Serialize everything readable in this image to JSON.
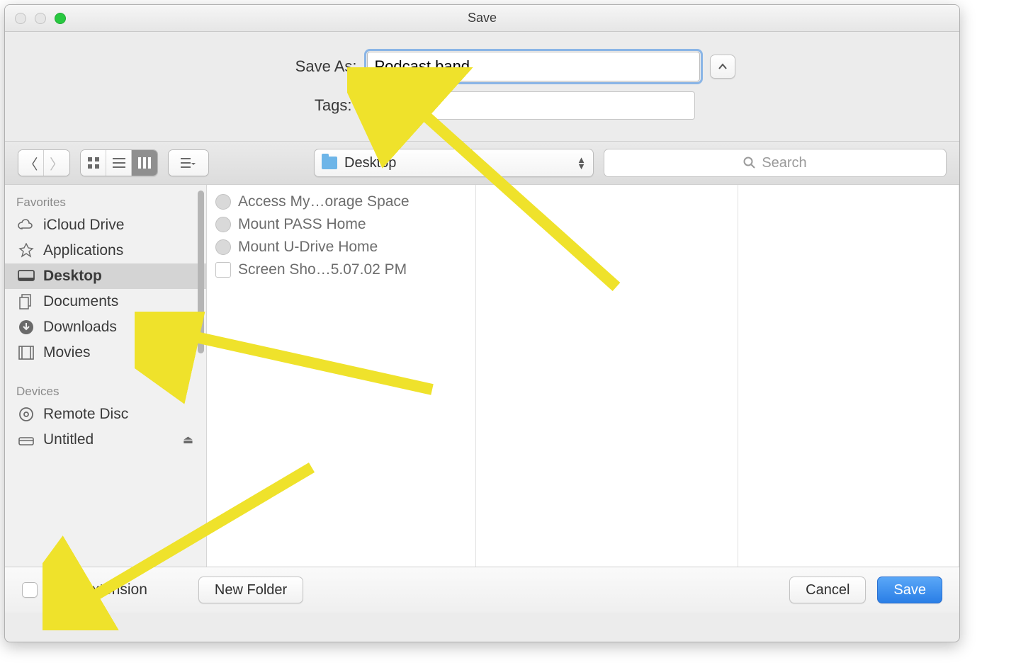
{
  "window": {
    "title": "Save"
  },
  "header": {
    "save_as_label": "Save As:",
    "filename": "Podcast.band",
    "tags_label": "Tags:",
    "tags_value": ""
  },
  "toolbar": {
    "location": "Desktop",
    "search_placeholder": "Search"
  },
  "sidebar": {
    "favorites_header": "Favorites",
    "devices_header": "Devices",
    "favorites": [
      {
        "label": "iCloud Drive",
        "icon": "cloud-icon"
      },
      {
        "label": "Applications",
        "icon": "applications-icon"
      },
      {
        "label": "Desktop",
        "icon": "desktop-icon",
        "selected": true
      },
      {
        "label": "Documents",
        "icon": "documents-icon"
      },
      {
        "label": "Downloads",
        "icon": "downloads-icon"
      },
      {
        "label": "Movies",
        "icon": "movies-icon"
      }
    ],
    "devices": [
      {
        "label": "Remote Disc",
        "icon": "disc-icon"
      },
      {
        "label": "Untitled",
        "icon": "drive-icon",
        "ejectable": true
      }
    ]
  },
  "files": [
    {
      "label": "Access My…orage Space",
      "type": "link"
    },
    {
      "label": "Mount PASS Home",
      "type": "link"
    },
    {
      "label": "Mount U-Drive Home",
      "type": "link"
    },
    {
      "label": "Screen Sho…5.07.02 PM",
      "type": "doc"
    }
  ],
  "footer": {
    "hide_extension_label": "Hide extension",
    "hide_extension_checked": false,
    "new_folder_label": "New Folder",
    "cancel_label": "Cancel",
    "save_label": "Save"
  }
}
